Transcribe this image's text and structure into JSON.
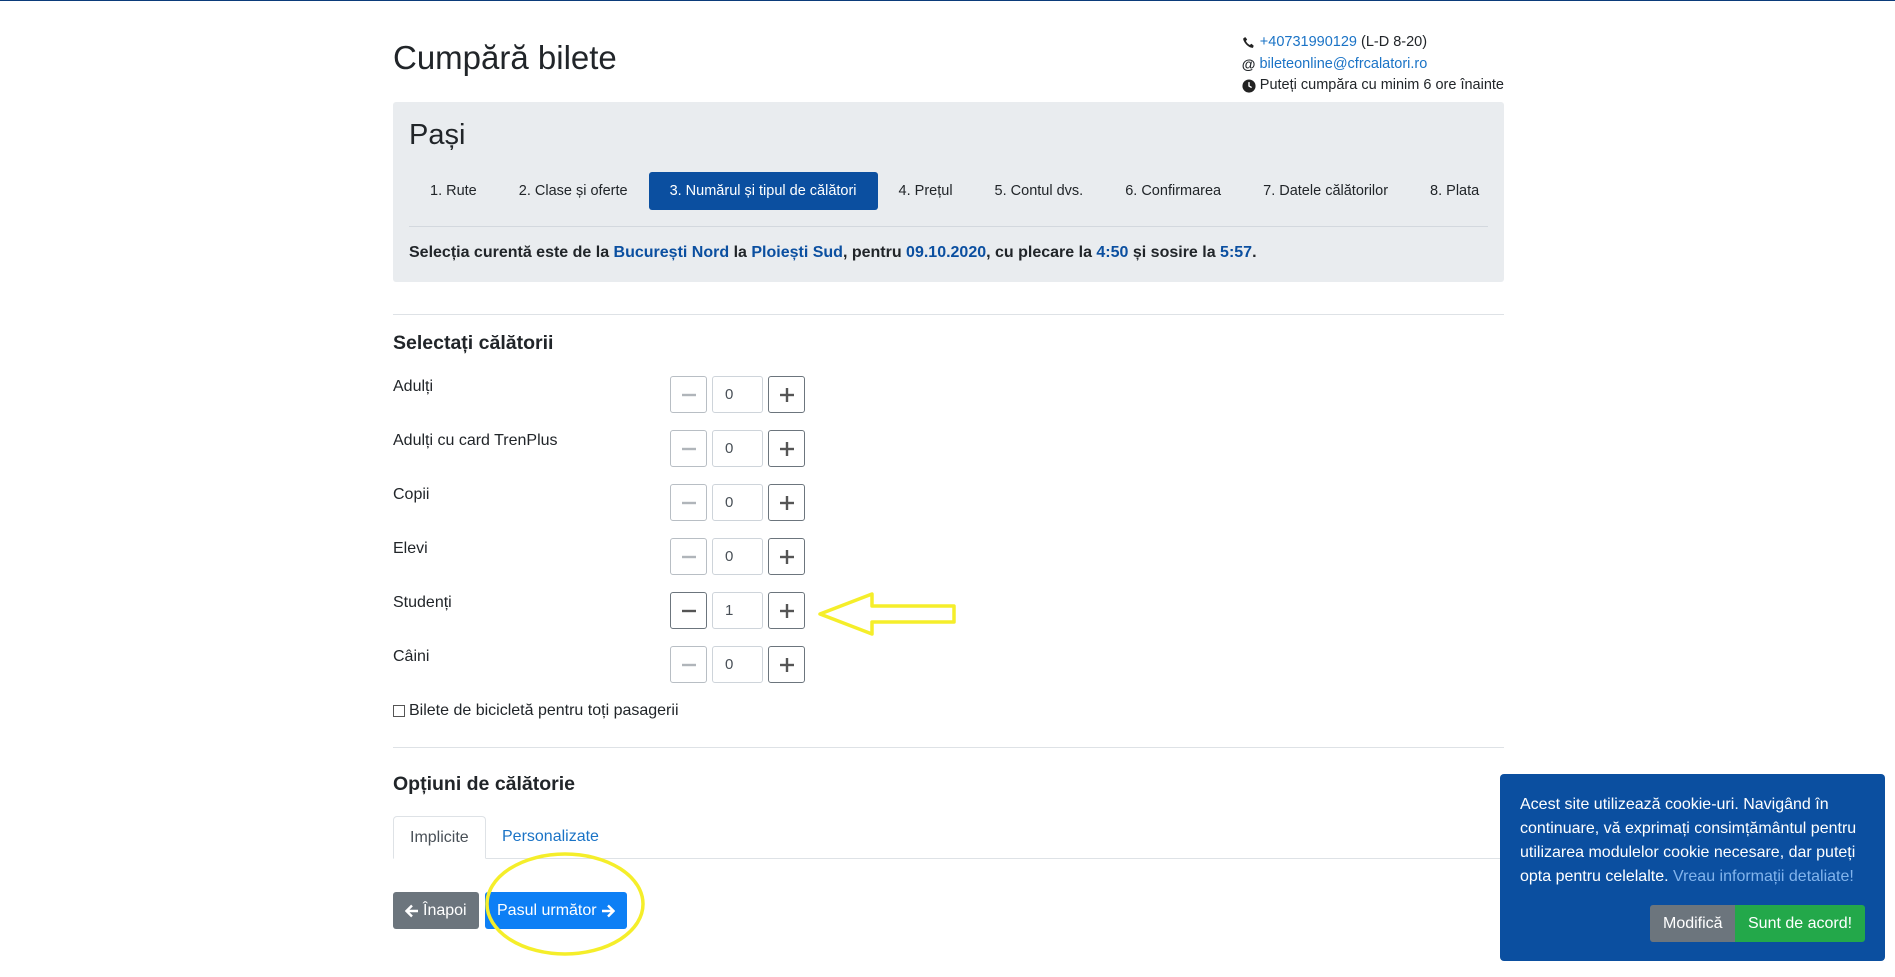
{
  "page": {
    "title": "Cumpără bilete"
  },
  "contact": {
    "phone": "+40731990129",
    "phone_hours": "(L-D 8-20)",
    "email": "bileteonline@cfrcalatori.ro",
    "notice": "Puteți cumpăra cu minim 6 ore înainte"
  },
  "steps": {
    "title": "Pași",
    "items": [
      {
        "label": "1. Rute",
        "active": false
      },
      {
        "label": "2. Clase și oferte",
        "active": false
      },
      {
        "label": "3. Numărul și tipul de călători",
        "active": true
      },
      {
        "label": "4. Prețul",
        "active": false
      },
      {
        "label": "5. Contul dvs.",
        "active": false
      },
      {
        "label": "6. Confirmarea",
        "active": false
      },
      {
        "label": "7. Datele călătorilor",
        "active": false
      },
      {
        "label": "8. Plata",
        "active": false
      }
    ],
    "selection": {
      "prefix": "Selecția curentă este de la ",
      "from": "București Nord",
      "to_word": " la ",
      "to": "Ploiești Sud",
      "date_word": ", pentru ",
      "date": "09.10.2020",
      "departure_word": ", cu plecare la ",
      "departure": "4:50",
      "arrival_word": " și sosire la ",
      "arrival": "5:57",
      "suffix": "."
    }
  },
  "travelers": {
    "title": "Selectați călătorii",
    "rows": [
      {
        "label": "Adulți",
        "value": "0"
      },
      {
        "label": "Adulți cu card TrenPlus",
        "value": "0"
      },
      {
        "label": "Copii",
        "value": "0"
      },
      {
        "label": "Elevi",
        "value": "0"
      },
      {
        "label": "Studenți",
        "value": "1"
      },
      {
        "label": "Câini",
        "value": "0"
      }
    ],
    "bike_label": "Bilete de bicicletă pentru toți pasagerii",
    "bike_checked": false
  },
  "options": {
    "title": "Opțiuni de călătorie",
    "tabs": [
      "Implicite",
      "Personalizate"
    ]
  },
  "buttons": {
    "back": "Înapoi",
    "next": "Pasul următor"
  },
  "cookie": {
    "text": "Acest site utilizează cookie-uri. Navigând în continuare, vă exprimați consimțământul pentru utilizarea modulelor cookie necesare, dar puteți opta pentru celelalte.",
    "more_link": "Vreau informații detaliate!",
    "modify": "Modifică",
    "agree": "Sunt de acord!"
  },
  "colors": {
    "primary_dark": "#0b4fa0",
    "primary": "#0d7ff5",
    "secondary": "#6c757d",
    "success": "#23a84a",
    "annotation": "#f5ee2a"
  }
}
